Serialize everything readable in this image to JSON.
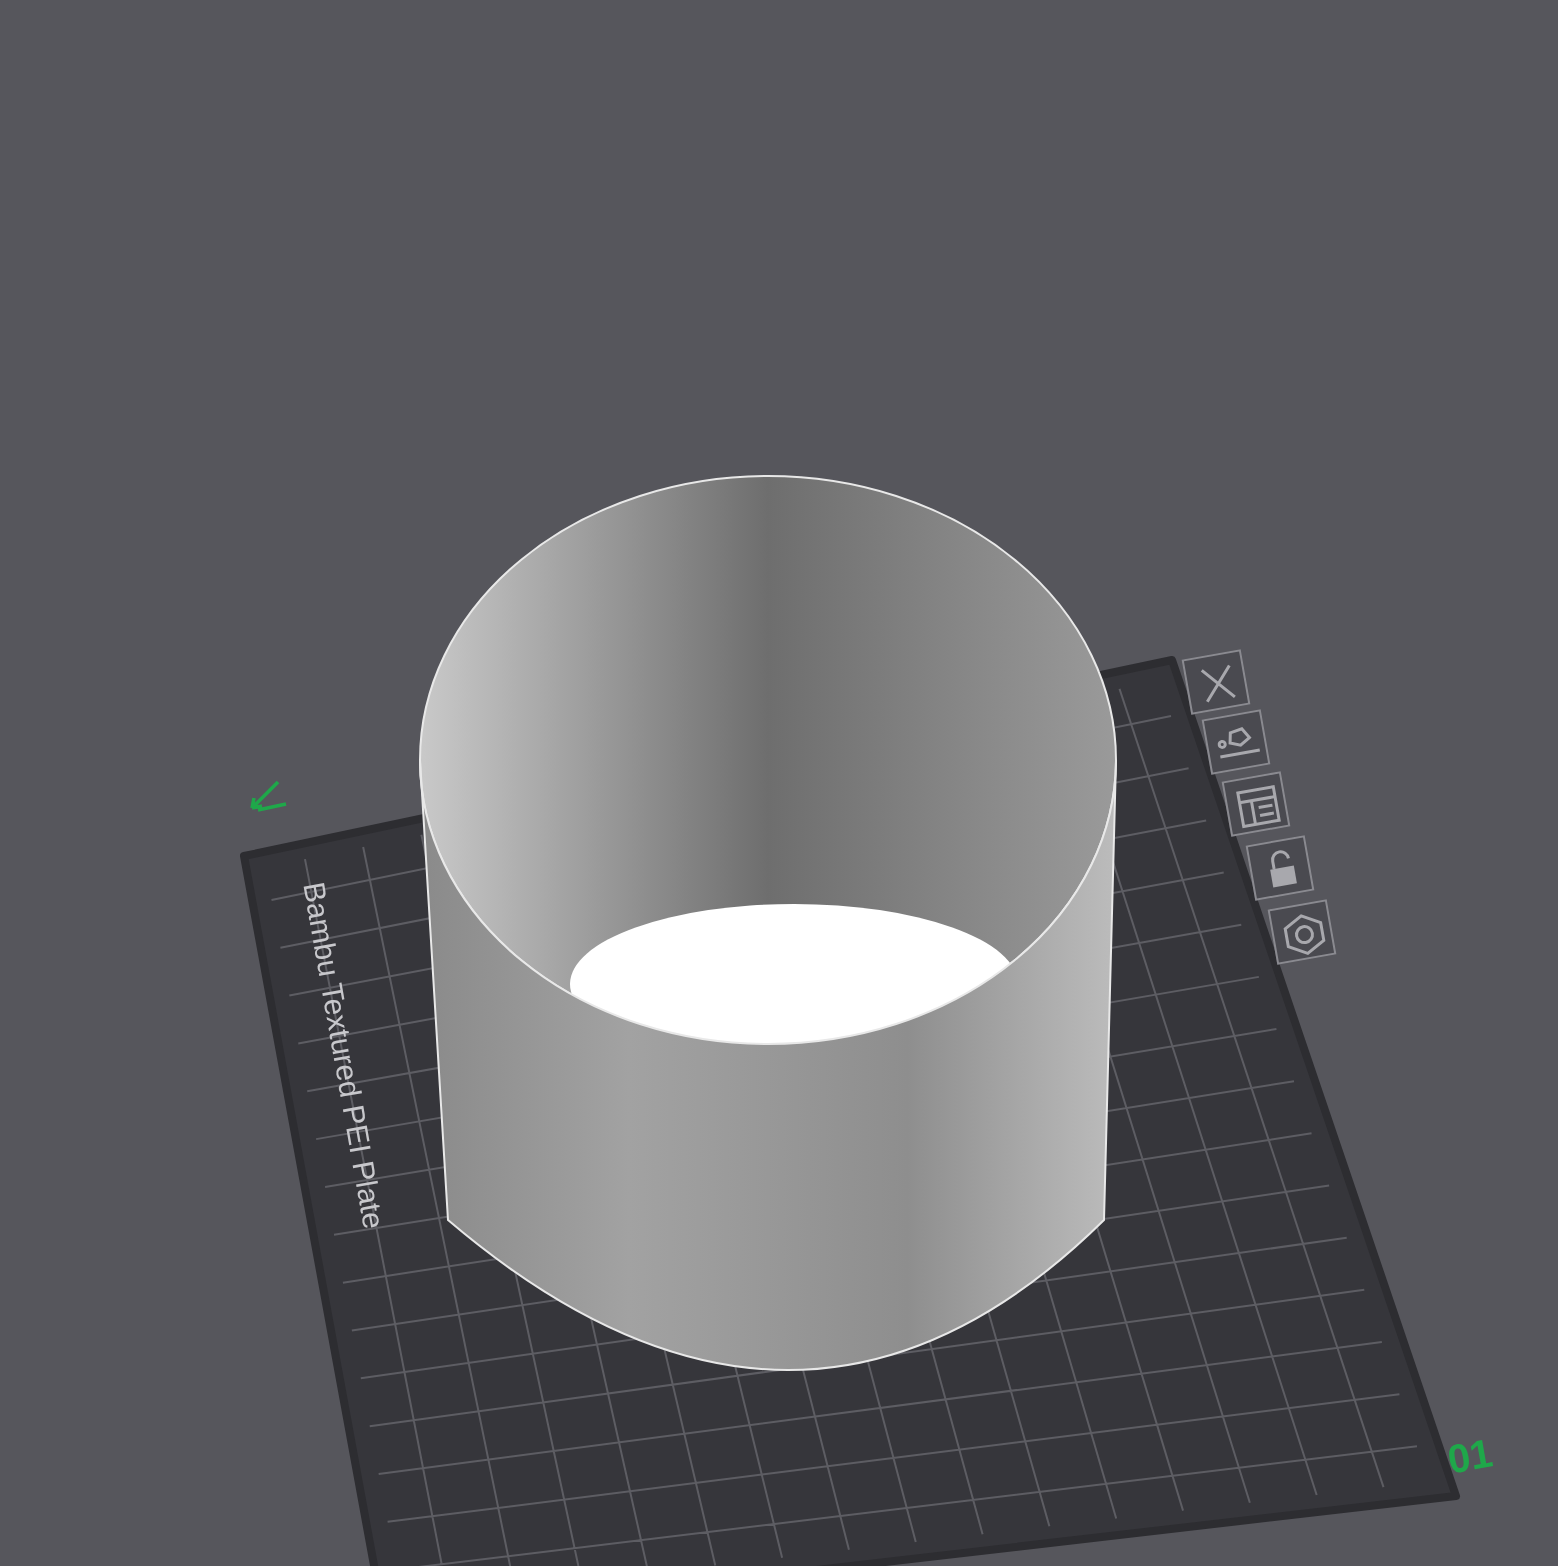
{
  "plate": {
    "label": "Bambu Textured PEI Plate",
    "number": "01"
  }
}
